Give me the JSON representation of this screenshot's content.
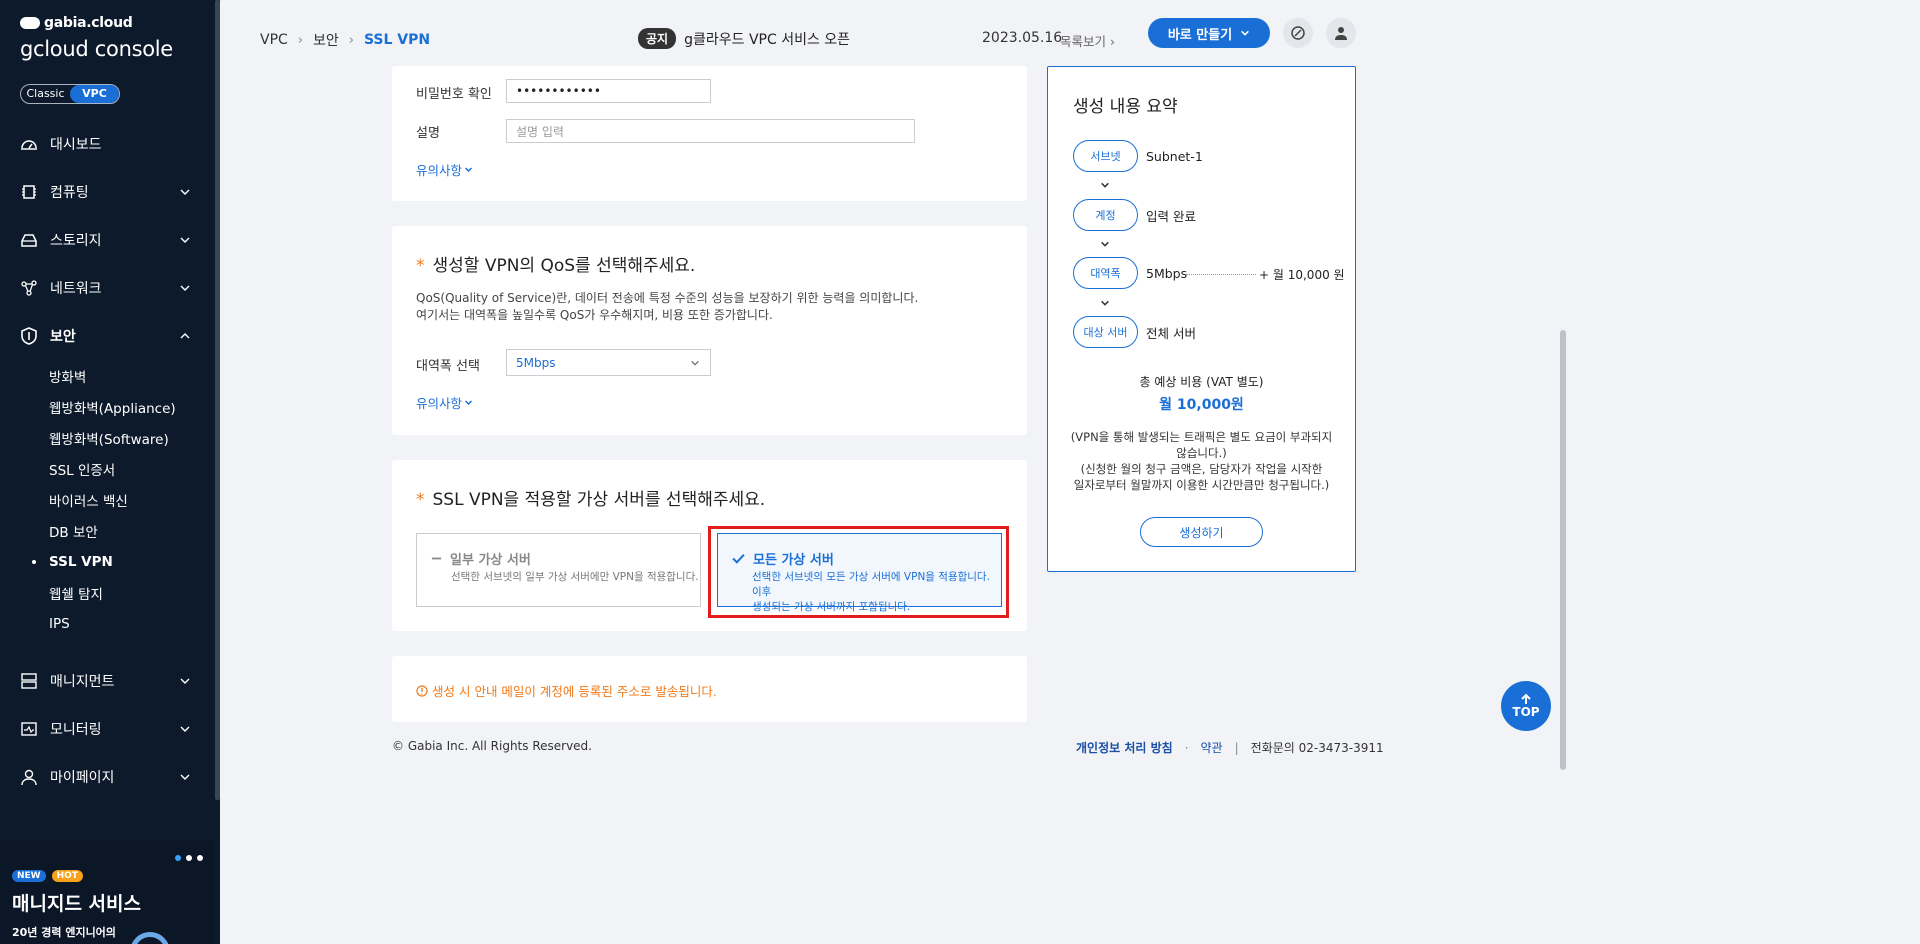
{
  "sidebar": {
    "brand_small": "gabia.cloud",
    "brand_big": "gcloud console",
    "toggle": {
      "classic": "Classic",
      "vpc": "VPC"
    },
    "menu": [
      {
        "label": "대시보드"
      },
      {
        "label": "컴퓨팅"
      },
      {
        "label": "스토리지"
      },
      {
        "label": "네트워크"
      },
      {
        "label": "보안"
      }
    ],
    "security_sub": [
      "방화벽",
      "웹방화벽(Appliance)",
      "웹방화벽(Software)",
      "SSL 인증서",
      "바이러스 백신",
      "DB 보안",
      "SSL VPN",
      "웹쉘 탐지",
      "IPS"
    ],
    "menu_bottom": [
      {
        "label": "매니지먼트"
      },
      {
        "label": "모니터링"
      },
      {
        "label": "마이페이지"
      }
    ],
    "promo": {
      "tag_new": "NEW",
      "tag_hot": "HOT",
      "title": "매니지드 서비스",
      "subtitle": "20년 경력 엔지니어의"
    }
  },
  "header": {
    "breadcrumb": [
      "VPC",
      "보안",
      "SSL VPN"
    ],
    "notice_badge": "공지",
    "notice_text": "g클라우드 VPC 서비스 오픈",
    "notice_date": "2023.05.16",
    "notice_more": "목록보기",
    "make_button": "바로 만들기"
  },
  "account_card": {
    "pw_confirm_label": "비밀번호 확인",
    "pw_confirm_value": "••••••••••••",
    "desc_label": "설명",
    "desc_placeholder": "설명 입력",
    "caution_link": "유의사항"
  },
  "qos_card": {
    "star": "*",
    "title": "생성할 VPN의 QoS를 선택해주세요.",
    "desc_line1": "QoS(Quality of Service)란, 데이터 전송에 특정 수준의 성능을 보장하기 위한 능력을 의미합니다.",
    "desc_line2": "여기서는 대역폭을 높일수록 QoS가 우수해지며, 비용 또한 증가합니다.",
    "bandwidth_label": "대역폭 선택",
    "bandwidth_value": "5Mbps",
    "caution_link": "유의사항"
  },
  "server_card": {
    "star": "*",
    "title": "SSL VPN을 적용할 가상 서버를 선택해주세요.",
    "option_partial": {
      "title": "일부 가상 서버",
      "desc": "선택한 서브넷의 일부 가상 서버에만 VPN을 적용합니다."
    },
    "option_all": {
      "title": "모든 가상 서버",
      "desc_line1": "선택한 서브넷의 모든 가상 서버에 VPN을 적용합니다. 이후",
      "desc_line2": "생성되는 가상 서버까지 포함됩니다."
    },
    "selected": "option_all"
  },
  "mail_notice": "생성 시 안내 메일이 계정에 등록된 주소로 발송됩니다.",
  "summary": {
    "title": "생성 내용 요약",
    "steps": [
      {
        "pill": "서브넷",
        "value": "Subnet-1"
      },
      {
        "pill": "계정",
        "value": "입력 완료"
      },
      {
        "pill": "대역폭",
        "value": "5Mbps"
      },
      {
        "pill": "대상 서버",
        "value": "전체 서버"
      }
    ],
    "bandwidth_price": "+ 월 10,000 원",
    "cost_label": "총 예상 비용 (VAT 별도)",
    "cost_value": "월 10,000원",
    "note1_line1": "(VPN을 통해 발생되는 트래픽은 별도 요금이 부과되지",
    "note1_line2": "않습니다.)",
    "note2_line1": "(신청한 월의 청구 금액은, 담당자가 작업을 시작한",
    "note2_line2": "일자로부터 월말까지 이용한 시간만큼만 청구됩니다.)",
    "create_button": "생성하기"
  },
  "footer": {
    "copyright": "© Gabia Inc. All Rights Reserved.",
    "privacy": "개인정보 처리 방침",
    "dot": "·",
    "terms": "약관",
    "bar": "|",
    "contact": "전화문의  02-3473-3911"
  },
  "top_button": "TOP",
  "colors": {
    "accent": "#1a6fd6",
    "sidebar_bg": "#0d1a2b",
    "warning": "#f07a1a",
    "highlight": "#e21c1c"
  }
}
